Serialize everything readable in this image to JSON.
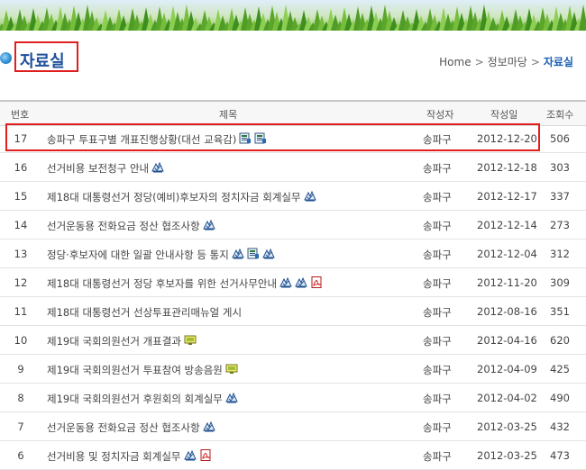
{
  "page": {
    "title": "자료실",
    "breadcrumb": [
      "Home",
      "정보마당",
      "자료실"
    ]
  },
  "table": {
    "headers": {
      "no": "번호",
      "title": "제목",
      "author": "작성자",
      "date": "작성일",
      "views": "조회수"
    },
    "rows": [
      {
        "no": "17",
        "title": "송파구 투표구별 개표진행상황(대선 교육감)",
        "author": "송파구",
        "date": "2012-12-20",
        "views": "506",
        "attachments": [
          "hwp-icon",
          "hwp-icon"
        ]
      },
      {
        "no": "16",
        "title": "선거비용 보전청구 안내",
        "author": "송파구",
        "date": "2012-12-18",
        "views": "303",
        "attachments": [
          "file-icon"
        ]
      },
      {
        "no": "15",
        "title": "제18대 대통령선거 정당(예비)후보자의 정치자금 회계실무",
        "author": "송파구",
        "date": "2012-12-17",
        "views": "337",
        "attachments": [
          "file-icon"
        ]
      },
      {
        "no": "14",
        "title": "선거운동용 전화요금 정산 협조사항",
        "author": "송파구",
        "date": "2012-12-14",
        "views": "273",
        "attachments": [
          "file-icon"
        ]
      },
      {
        "no": "13",
        "title": "정당·후보자에 대한 일괄 안내사항 등 통지",
        "author": "송파구",
        "date": "2012-12-04",
        "views": "312",
        "attachments": [
          "file-icon",
          "hwp-icon",
          "file-icon"
        ]
      },
      {
        "no": "12",
        "title": "제18대 대통령선거 정당 후보자를 위한 선거사무안내",
        "author": "송파구",
        "date": "2012-11-20",
        "views": "309",
        "attachments": [
          "file-icon",
          "file-icon",
          "pdf-icon"
        ]
      },
      {
        "no": "11",
        "title": "제18대 대통령선거 선상투표관리매뉴얼 게시",
        "author": "송파구",
        "date": "2012-08-16",
        "views": "351",
        "attachments": []
      },
      {
        "no": "10",
        "title": "제19대 국회의원선거 개표결과",
        "author": "송파구",
        "date": "2012-04-16",
        "views": "620",
        "attachments": [
          "media-icon"
        ]
      },
      {
        "no": "9",
        "title": "제19대 국회의원선거 투표참여 방송음원",
        "author": "송파구",
        "date": "2012-04-09",
        "views": "425",
        "attachments": [
          "media-icon"
        ]
      },
      {
        "no": "8",
        "title": "제19대 국회의원선거 후원회의 회계실무",
        "author": "송파구",
        "date": "2012-04-02",
        "views": "490",
        "attachments": [
          "file-icon"
        ]
      },
      {
        "no": "7",
        "title": "선거운동용 전화요금 정산 협조사항",
        "author": "송파구",
        "date": "2012-03-25",
        "views": "432",
        "attachments": [
          "file-icon"
        ]
      },
      {
        "no": "6",
        "title": "선거비용 및 정치자금 회계실무",
        "author": "송파구",
        "date": "2012-03-25",
        "views": "473",
        "attachments": [
          "file-icon",
          "pdf-icon"
        ]
      }
    ]
  },
  "colors": {
    "title": "#1d4f9a",
    "breadcrumb_current": "#1d5fb4",
    "highlight_border": "#e01e1e"
  }
}
